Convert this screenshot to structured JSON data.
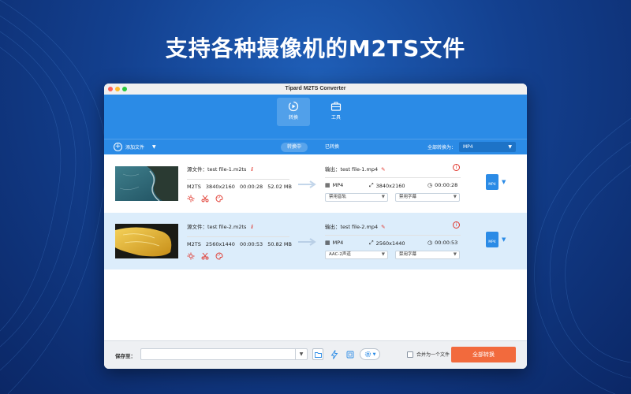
{
  "headline": "支持各种摄像机的M2TS文件",
  "window": {
    "title": "Tipard M2TS Converter"
  },
  "toolbar": {
    "convert_label": "转换",
    "toolbox_label": "工具"
  },
  "subbar": {
    "add_files_label": "添加文件",
    "tab_converting": "转换中",
    "tab_converted": "已转换",
    "convert_all_label": "全部转换为：",
    "convert_all_format": "MP4"
  },
  "files": [
    {
      "source_label": "源文件：test file-1.m2ts",
      "format": "M2TS",
      "resolution": "3840x2160",
      "duration": "00:00:28",
      "size": "52.02 MB",
      "output_label": "输出：test file-1.mp4",
      "out_format": "MP4",
      "out_resolution": "3840x2160",
      "out_duration": "00:00:28",
      "audio_select": "禁用音轨",
      "subtitle_select": "禁用字幕",
      "badge": "MP4"
    },
    {
      "source_label": "源文件：test file-2.m2ts",
      "format": "M2TS",
      "resolution": "2560x1440",
      "duration": "00:00:53",
      "size": "50.82 MB",
      "output_label": "输出：test file-2.mp4",
      "out_format": "MP4",
      "out_resolution": "2560x1440",
      "out_duration": "00:00:53",
      "audio_select": "AAC-2声道",
      "subtitle_select": "禁用字幕",
      "badge": "MP4"
    }
  ],
  "bottom": {
    "save_to_label": "保存至：",
    "save_path": "",
    "merge_label": "合并为一个文件",
    "convert_all_button": "全部转换"
  },
  "colors": {
    "accent": "#2b8be6",
    "convert_button": "#f26a3d",
    "warning": "#e0352b"
  }
}
